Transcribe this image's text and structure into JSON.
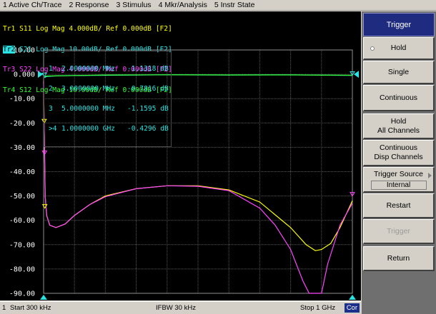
{
  "menu": [
    {
      "label": "1 Active Ch/Trace"
    },
    {
      "label": "2 Response"
    },
    {
      "label": "3 Stimulus"
    },
    {
      "label": "4 Mkr/Analysis"
    },
    {
      "label": "5 Instr State"
    }
  ],
  "traces": [
    {
      "text": "Tr1 S11 Log Mag 4.000dB/ Ref 0.000dB [F2]",
      "color": "#ffff00",
      "active": false
    },
    {
      "text": "S21 Log Mag 10.00dB/ Ref 0.000dB [F2]",
      "prefix": "Tr2",
      "color": "#2ce3e3",
      "active": true
    },
    {
      "text": "Tr3 S22 Log Mag 4.000dB/ Ref 0.000dB [F2]",
      "color": "#ff44ff",
      "active": false
    },
    {
      "text": "Tr4 S12 Log Mag 10.00dB/ Ref 0.000dB [F2]",
      "color": "#33ff33",
      "active": false
    }
  ],
  "markers": [
    {
      "num": "1",
      "freq": "2.0000000 MHz",
      "value": "-1.1318 dB"
    },
    {
      "num": "2",
      "freq": "3.0000000 MHz",
      "value": "-0.7816 dB"
    },
    {
      "num": "3",
      "freq": "5.0000000 MHz",
      "value": "-1.1595 dB"
    },
    {
      "num": ">4",
      "freq": "1.0000000 GHz",
      "value": "-0.4296 dB"
    }
  ],
  "chart_data": {
    "type": "line",
    "x_axis": {
      "start_label": "Start 300 kHz",
      "stop_label": "Stop 1 GHz",
      "range": [
        0,
        1
      ]
    },
    "y_axis": {
      "range": [
        -90,
        10
      ],
      "tick_labels": [
        "10.00",
        "0.000",
        "-10.00",
        "-20.00",
        "-30.00",
        "-40.00",
        "-50.00",
        "-60.00",
        "-70.00",
        "-80.00",
        "-90.00"
      ],
      "ref_value": 0,
      "ref_label": "0.000"
    },
    "grid": true,
    "series": [
      {
        "trace": "Tr1",
        "color": "#ffff00",
        "x": [
          0,
          0.005,
          0.01,
          0.02,
          0.04,
          0.07,
          0.1,
          0.15,
          0.2,
          0.3,
          0.4,
          0.5,
          0.6,
          0.7,
          0.8,
          0.85,
          0.88,
          0.9,
          0.93,
          0.96,
          1.0
        ],
        "y": [
          -3,
          -50,
          -58,
          -62,
          -63,
          -61.5,
          -58,
          -53.5,
          -50,
          -47,
          -45.8,
          -45.8,
          -47.5,
          -52.5,
          -63,
          -70,
          -72.5,
          -72,
          -69.5,
          -63,
          -52
        ]
      },
      {
        "trace": "Tr3",
        "color": "#ff44ff",
        "x": [
          0,
          0.005,
          0.01,
          0.02,
          0.04,
          0.07,
          0.1,
          0.15,
          0.2,
          0.3,
          0.4,
          0.5,
          0.6,
          0.7,
          0.75,
          0.8,
          0.84,
          0.86,
          0.87,
          0.9,
          0.92,
          0.96,
          1.0
        ],
        "y": [
          -3,
          -50,
          -58,
          -62,
          -63,
          -61.5,
          -58,
          -53.5,
          -50.3,
          -47,
          -45.8,
          -46,
          -47.8,
          -55,
          -62,
          -72,
          -85,
          -90,
          -90,
          -90,
          -78,
          -62,
          -53
        ]
      },
      {
        "trace": "Tr2",
        "color": "#2ce3e3",
        "x": [
          0,
          0.005,
          0.01,
          0.05,
          0.2,
          0.4,
          0.6,
          0.8,
          0.95,
          1.0
        ],
        "y": [
          -1.5,
          -1.2,
          -0.9,
          -0.6,
          -0.4,
          -0.2,
          -0.3,
          -0.2,
          -0.4,
          -0.43
        ]
      },
      {
        "trace": "Tr4",
        "color": "#33ff33",
        "x": [
          0,
          0.01,
          0.2,
          0.4,
          0.6,
          0.8,
          1.0
        ],
        "y": [
          -1.0,
          -0.7,
          -0.3,
          -0.2,
          -0.25,
          -0.25,
          -0.4
        ]
      }
    ]
  },
  "status": {
    "channel": "1",
    "start": "Start 300 kHz",
    "ifbw": "IFBW 30 kHz",
    "stop": "Stop 1 GHz",
    "cor": "Cor"
  },
  "softkeys": {
    "title": "Trigger",
    "hold": "Hold",
    "single": "Single",
    "continuous": "Continuous",
    "hold_all_line1": "Hold",
    "hold_all_line2": "All Channels",
    "cont_disp_line1": "Continuous",
    "cont_disp_line2": "Disp Channels",
    "trigger_source_label": "Trigger Source",
    "trigger_source_value": "Internal",
    "restart": "Restart",
    "trigger": "Trigger",
    "return": "Return"
  }
}
